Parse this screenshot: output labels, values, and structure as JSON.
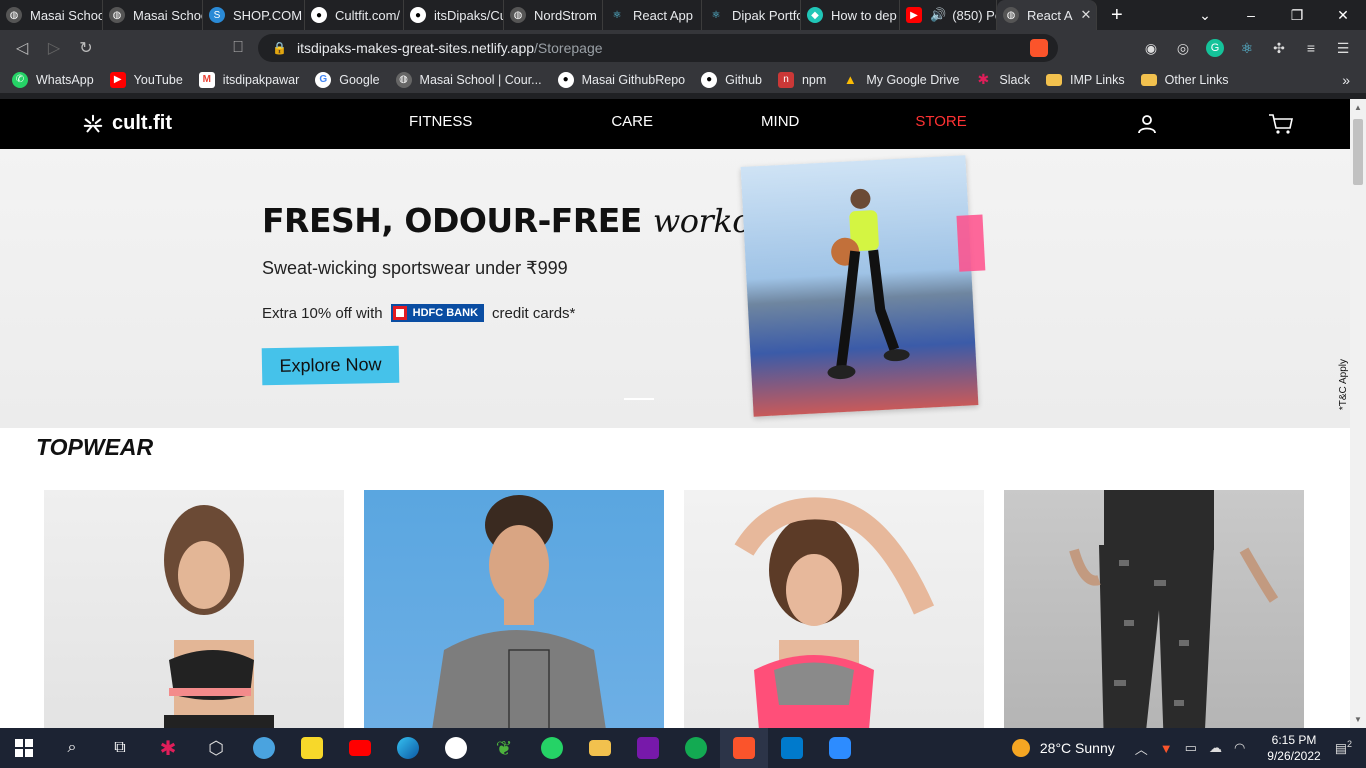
{
  "browser": {
    "tabs": [
      {
        "label": "Masai Schoo",
        "icon": "globe-icon",
        "color": "#555"
      },
      {
        "label": "Masai Schoo",
        "icon": "globe-icon",
        "color": "#555"
      },
      {
        "label": "SHOP.COM",
        "icon": "shopcom-icon",
        "color": "#2a8ad6"
      },
      {
        "label": "Cultfit.com/",
        "icon": "github-icon",
        "color": "#333"
      },
      {
        "label": "itsDipaks/Cu",
        "icon": "github-icon",
        "color": "#333"
      },
      {
        "label": "NordStrom",
        "icon": "globe-icon",
        "color": "#555"
      },
      {
        "label": "React App",
        "icon": "react-icon",
        "color": "#2c3e50"
      },
      {
        "label": "Dipak Portfo",
        "icon": "react-icon",
        "color": "#2c3e50"
      },
      {
        "label": "How to dep",
        "icon": "netlify-icon",
        "color": "#20c6b7"
      },
      {
        "label": "(850) Pe",
        "icon": "youtube-icon",
        "color": "#ff0000"
      },
      {
        "label": "React A",
        "icon": "globe-icon",
        "color": "#555"
      }
    ],
    "address": {
      "host": "itsdipaks-makes-great-sites.netlify.app",
      "path": "/Storepage"
    },
    "bookmarks": [
      {
        "label": "WhatsApp",
        "icon": "whatsapp-icon",
        "color": "#25d366"
      },
      {
        "label": "YouTube",
        "icon": "youtube-icon",
        "color": "#ff0000"
      },
      {
        "label": "itsdipakpawar",
        "icon": "gmail-icon",
        "color": "#ea4335"
      },
      {
        "label": "Google",
        "icon": "google-icon",
        "color": "#fff"
      },
      {
        "label": "Masai School | Cour...",
        "icon": "globe-icon",
        "color": "#666"
      },
      {
        "label": "Masai GithubRepo",
        "icon": "github-icon",
        "color": "#333"
      },
      {
        "label": "Github",
        "icon": "github-icon",
        "color": "#333"
      },
      {
        "label": "npm",
        "icon": "npm-icon",
        "color": "#cb3837"
      },
      {
        "label": "My Google Drive",
        "icon": "drive-icon",
        "color": "#fbbc04"
      },
      {
        "label": "Slack",
        "icon": "slack-icon",
        "color": "#611f69"
      },
      {
        "label": "IMP Links",
        "icon": "folder-icon",
        "color": "#f2c14e"
      },
      {
        "label": "Other Links",
        "icon": "folder-icon",
        "color": "#f2c14e"
      }
    ]
  },
  "site": {
    "logo": "cult.fit",
    "nav": [
      "FITNESS",
      "CARE",
      "MIND",
      "STORE"
    ],
    "active_nav_color": "#ff3233"
  },
  "banner": {
    "headline_bold": "FRESH, ODOUR-FREE",
    "headline_script": "workouts",
    "subline": "Sweat-wicking sportswear under ₹999",
    "offer_prefix": "Extra 10% off with",
    "bank": "HDFC BANK",
    "offer_suffix": "credit cards*",
    "cta": "Explore Now",
    "tc": "*T&C Apply"
  },
  "section": {
    "title": "TOPWEAR"
  },
  "taskbar": {
    "weather": "28°C  Sunny",
    "time": "6:15 PM",
    "date": "9/26/2022",
    "notifications": "2"
  }
}
